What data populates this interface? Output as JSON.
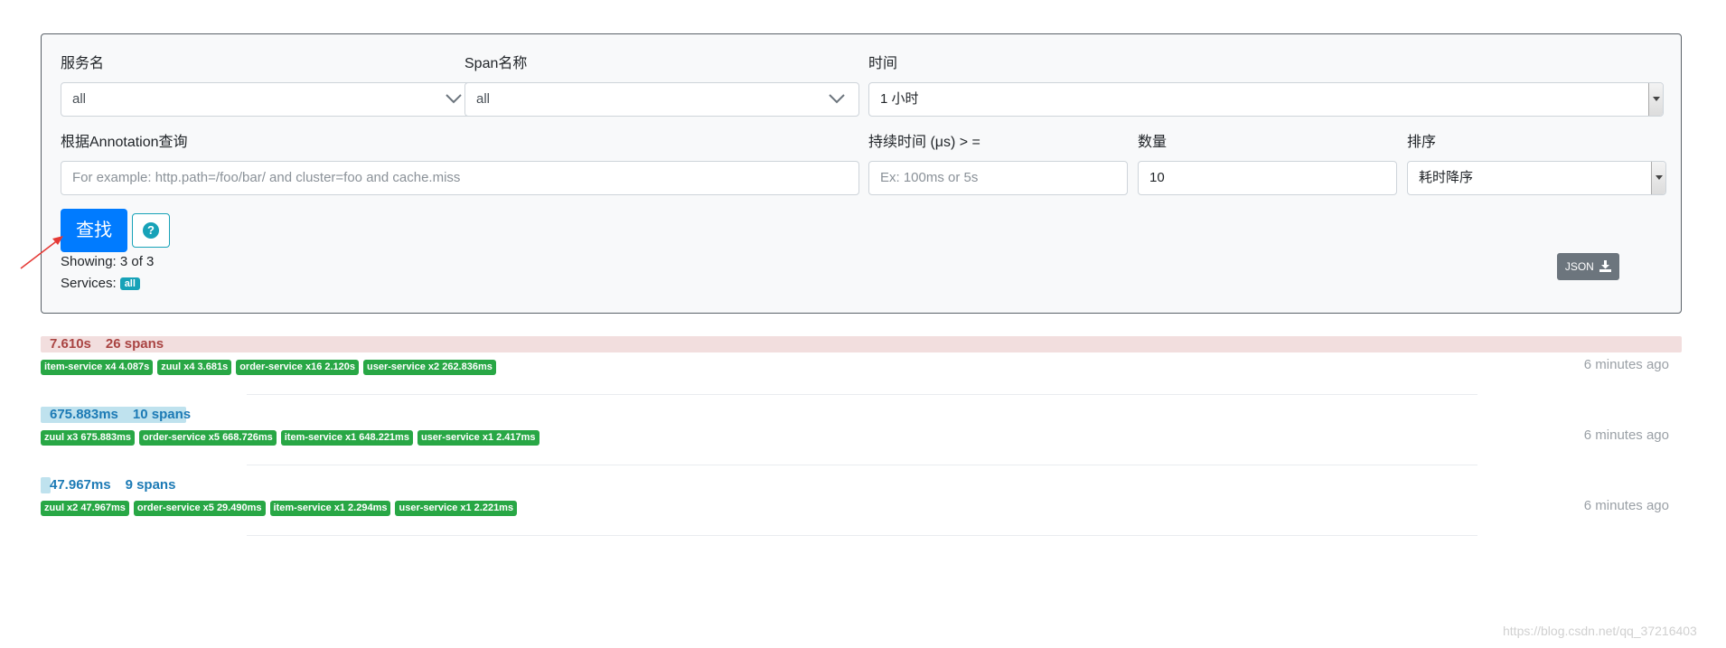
{
  "search": {
    "service_label": "服务名",
    "service_value": "all",
    "span_label": "Span名称",
    "span_value": "all",
    "time_label": "时间",
    "time_value": "1 小时",
    "annotation_label": "根据Annotation查询",
    "annotation_placeholder": "For example: http.path=/foo/bar/ and cluster=foo and cache.miss",
    "duration_label": "持续时间 (μs) > =",
    "duration_placeholder": "Ex: 100ms or 5s",
    "limit_label": "数量",
    "limit_value": "10",
    "sort_label": "排序",
    "sort_value": "耗时降序",
    "search_button": "查找",
    "help_icon": "?",
    "showing": "Showing: 3 of 3",
    "services_label": "Services:",
    "services_badge": "all",
    "json_button": "JSON"
  },
  "traces": [
    {
      "duration": "7.610s",
      "spans": "26 spans",
      "bar_fraction": 1.0,
      "bar_color": "#f2dede",
      "text_color": "#a94442",
      "time_ago": "6 minutes ago",
      "tags": [
        "item-service x4 4.087s",
        "zuul x4 3.681s",
        "order-service x16 2.120s",
        "user-service x2 262.836ms"
      ]
    },
    {
      "duration": "675.883ms",
      "spans": "10 spans",
      "bar_fraction": 0.0888,
      "bar_color": "#bfe2ee",
      "text_color": "#1c7ab5",
      "time_ago": "6 minutes ago",
      "tags": [
        "zuul x3 675.883ms",
        "order-service x5 668.726ms",
        "item-service x1 648.221ms",
        "user-service x1 2.417ms"
      ]
    },
    {
      "duration": "47.967ms",
      "spans": "9 spans",
      "bar_fraction": 0.0063,
      "bar_color": "#bfe2ee",
      "text_color": "#1c7ab5",
      "time_ago": "6 minutes ago",
      "tags": [
        "zuul x2 47.967ms",
        "order-service x5 29.490ms",
        "item-service x1 2.294ms",
        "user-service x1 2.221ms"
      ]
    }
  ],
  "watermark": "https://blog.csdn.net/qq_37216403",
  "icons": {
    "service_chevron": "chevron-down-icon",
    "span_chevron": "chevron-down-icon",
    "help": "question-circle-icon",
    "json": "download-icon"
  }
}
